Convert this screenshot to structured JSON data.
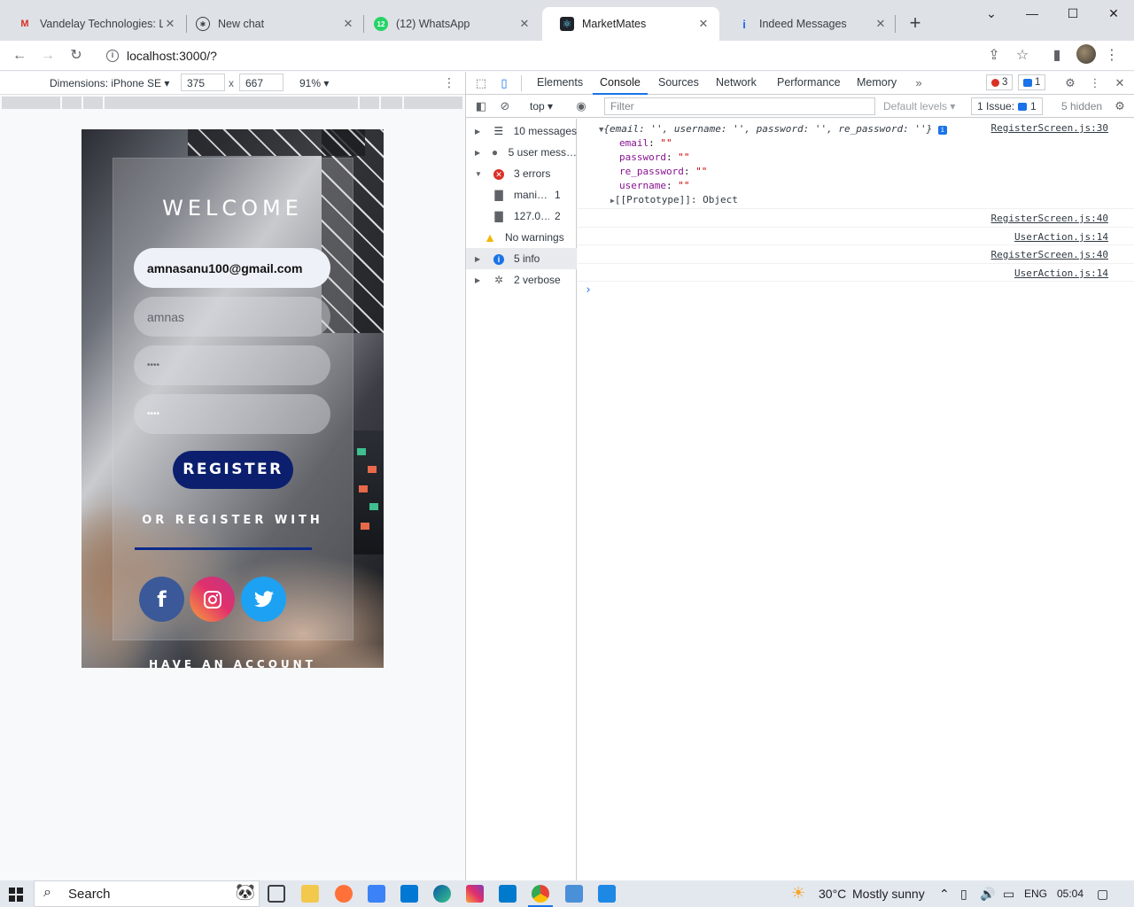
{
  "tabs": [
    {
      "title": "Vandelay Technologies: Li",
      "icon": "gmail-icon",
      "active": false
    },
    {
      "title": "New chat",
      "icon": "chatgpt-icon",
      "active": false
    },
    {
      "title": "(12) WhatsApp",
      "icon": "whatsapp-icon",
      "active": false
    },
    {
      "title": "MarketMates",
      "icon": "react-icon",
      "active": true
    },
    {
      "title": "Indeed Messages",
      "icon": "indeed-icon",
      "active": false
    }
  ],
  "address": {
    "url": "localhost:3000/?"
  },
  "device_toolbar": {
    "dimensions_label": "Dimensions: iPhone SE",
    "width": "375",
    "times": "x",
    "height": "667",
    "zoom": "91%"
  },
  "app": {
    "welcome": "WELCOME",
    "email_value": "amnasanu100@gmail.com",
    "username_value": "amnas",
    "password_value": "••••",
    "re_password_value": "••••",
    "register_label": "REGISTER",
    "or_register_with": "OR REGISTER WITH",
    "social": [
      {
        "name": "facebook",
        "glyph": "f",
        "color": "#3b5998"
      },
      {
        "name": "instagram",
        "glyph": "◎",
        "color": "#e1306c"
      },
      {
        "name": "twitter",
        "glyph": "🐦",
        "color": "#1da1f2"
      }
    ],
    "have_account": "HAVE AN ACCOUNT"
  },
  "devtools": {
    "tabs": [
      "Elements",
      "Console",
      "Sources",
      "Network",
      "Performance",
      "Memory"
    ],
    "active_tab": "Console",
    "error_count": "3",
    "message_count": "1",
    "context": "top",
    "filter_placeholder": "Filter",
    "levels": "Default levels",
    "issues": "1 Issue:",
    "issues_count": "1",
    "hidden": "5 hidden",
    "sidebar": [
      {
        "label": "10 messages",
        "icon": "list-icon",
        "expanded": false
      },
      {
        "label": "5 user mess…",
        "icon": "user-icon",
        "expanded": false
      },
      {
        "label": "3 errors",
        "icon": "error-icon",
        "expanded": true
      },
      {
        "label": "mani…",
        "count": "1",
        "icon": "file-icon",
        "child": true
      },
      {
        "label": "127.0…",
        "count": "2",
        "icon": "file-icon",
        "child": true
      },
      {
        "label": "No warnings",
        "icon": "warning-icon",
        "expanded": false
      },
      {
        "label": "5 info",
        "icon": "info-icon",
        "expanded": false
      },
      {
        "label": "2 verbose",
        "icon": "bug-icon",
        "expanded": false
      }
    ],
    "console": {
      "object_summary": "{email: '', username: '', password: '', re_password: ''}",
      "props": [
        {
          "key": "email",
          "value": "\"\""
        },
        {
          "key": "password",
          "value": "\"\""
        },
        {
          "key": "re_password",
          "value": "\"\""
        },
        {
          "key": "username",
          "value": "\"\""
        }
      ],
      "prototype": "[[Prototype]]: Object",
      "sources": [
        "RegisterScreen.js:30",
        "RegisterScreen.js:40",
        "UserAction.js:14",
        "RegisterScreen.js:40",
        "UserAction.js:14"
      ]
    }
  },
  "taskbar": {
    "search": "Search",
    "weather": "30°C",
    "weather_desc": "Mostly sunny",
    "lang": "ENG",
    "time": "05:04"
  }
}
